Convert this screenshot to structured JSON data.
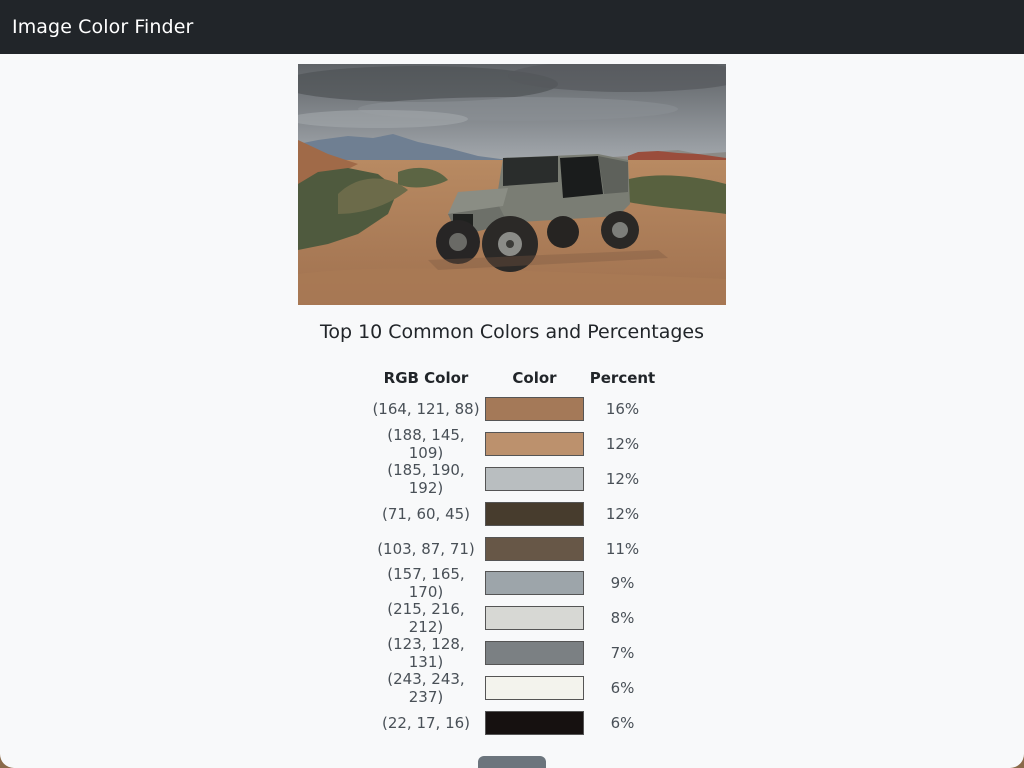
{
  "navbar": {
    "brand": "Image Color Finder"
  },
  "main": {
    "heading": "Top 10 Common Colors and Percentages",
    "table": {
      "headers": [
        "RGB Color",
        "Color",
        "Percent"
      ],
      "rows": [
        {
          "rgb": "(164, 121, 88)",
          "hex": "#a47958",
          "percent": "16%"
        },
        {
          "rgb": "(188, 145, 109)",
          "hex": "#bc916d",
          "percent": "12%"
        },
        {
          "rgb": "(185, 190, 192)",
          "hex": "#b9bec0",
          "percent": "12%"
        },
        {
          "rgb": "(71, 60, 45)",
          "hex": "#473c2d",
          "percent": "12%"
        },
        {
          "rgb": "(103, 87, 71)",
          "hex": "#675747",
          "percent": "11%"
        },
        {
          "rgb": "(157, 165, 170)",
          "hex": "#9da5aa",
          "percent": "9%"
        },
        {
          "rgb": "(215, 216, 212)",
          "hex": "#d7d8d4",
          "percent": "8%"
        },
        {
          "rgb": "(123, 128, 131)",
          "hex": "#7b8083",
          "percent": "7%"
        },
        {
          "rgb": "(243, 243, 237)",
          "hex": "#f3f3ed",
          "percent": "6%"
        },
        {
          "rgb": "(22, 17, 16)",
          "hex": "#161110",
          "percent": "6%"
        }
      ]
    },
    "button": {
      "label": ""
    }
  },
  "colors": {
    "navbar_bg": "#212529",
    "page_bg": "#f8f9fa",
    "button_bg": "#6c757d"
  }
}
